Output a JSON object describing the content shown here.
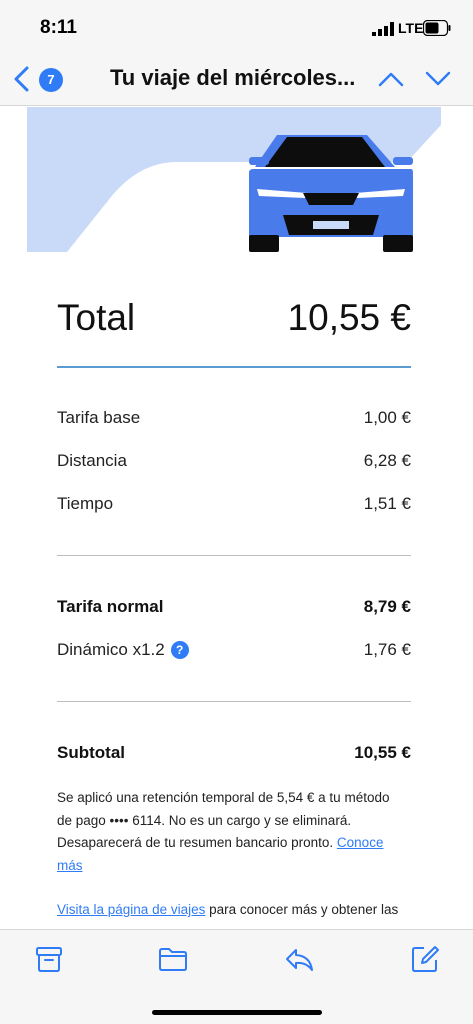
{
  "status_bar": {
    "time": "8:11",
    "network": "LTE"
  },
  "nav": {
    "back_count": "7",
    "title": "Tu viaje del miércoles...",
    "icons": [
      "chevron-left-icon",
      "chevron-up-icon",
      "chevron-down-icon"
    ]
  },
  "receipt": {
    "total_label": "Total",
    "total_value": "10,55 €",
    "lines": [
      {
        "label": "Tarifa base",
        "value": "1,00 €"
      },
      {
        "label": "Distancia",
        "value": "6,28 €"
      },
      {
        "label": "Tiempo",
        "value": "1,51 €"
      }
    ],
    "normal_label": "Tarifa normal",
    "normal_value": "8,79 €",
    "surge_label": "Dinámico x1.2",
    "surge_help": "?",
    "surge_value": "1,76 €",
    "subtotal_label": "Subtotal",
    "subtotal_value": "10,55 €"
  },
  "note": {
    "line1": "Se aplicó una retención temporal de 5,54 € a tu método",
    "line2": "de pago •••• 6114. No es un cargo y se eliminará.",
    "line3": "Desaparecerá de tu resumen bancario pronto. ",
    "link_a": "Conoce",
    "link_b": "más"
  },
  "visit": {
    "link": "Visita la página de viajes",
    "rest": " para conocer más y obtener las"
  },
  "toolbar": {
    "icons": [
      "archive-icon",
      "folder-icon",
      "reply-icon",
      "compose-icon"
    ]
  },
  "colors": {
    "accent": "#2f7cf6",
    "car_blue": "#4a7bea",
    "hero_bg": "#c9daf8",
    "rule_blue": "#5b9bd1"
  }
}
